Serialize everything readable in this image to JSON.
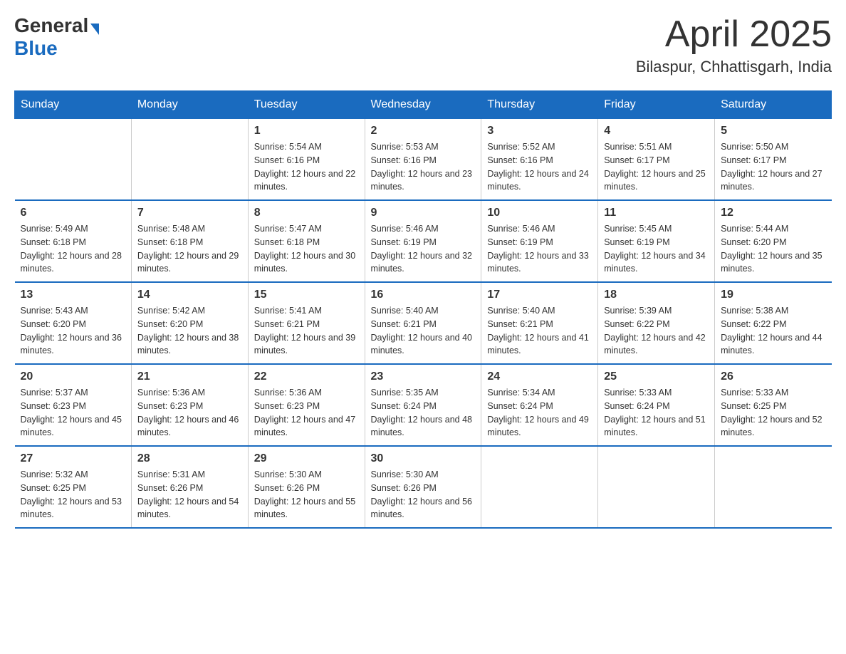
{
  "header": {
    "logo_general": "General",
    "logo_blue": "Blue",
    "month": "April 2025",
    "location": "Bilaspur, Chhattisgarh, India"
  },
  "weekdays": [
    "Sunday",
    "Monday",
    "Tuesday",
    "Wednesday",
    "Thursday",
    "Friday",
    "Saturday"
  ],
  "weeks": [
    [
      {
        "day": "",
        "sunrise": "",
        "sunset": "",
        "daylight": ""
      },
      {
        "day": "",
        "sunrise": "",
        "sunset": "",
        "daylight": ""
      },
      {
        "day": "1",
        "sunrise": "Sunrise: 5:54 AM",
        "sunset": "Sunset: 6:16 PM",
        "daylight": "Daylight: 12 hours and 22 minutes."
      },
      {
        "day": "2",
        "sunrise": "Sunrise: 5:53 AM",
        "sunset": "Sunset: 6:16 PM",
        "daylight": "Daylight: 12 hours and 23 minutes."
      },
      {
        "day": "3",
        "sunrise": "Sunrise: 5:52 AM",
        "sunset": "Sunset: 6:16 PM",
        "daylight": "Daylight: 12 hours and 24 minutes."
      },
      {
        "day": "4",
        "sunrise": "Sunrise: 5:51 AM",
        "sunset": "Sunset: 6:17 PM",
        "daylight": "Daylight: 12 hours and 25 minutes."
      },
      {
        "day": "5",
        "sunrise": "Sunrise: 5:50 AM",
        "sunset": "Sunset: 6:17 PM",
        "daylight": "Daylight: 12 hours and 27 minutes."
      }
    ],
    [
      {
        "day": "6",
        "sunrise": "Sunrise: 5:49 AM",
        "sunset": "Sunset: 6:18 PM",
        "daylight": "Daylight: 12 hours and 28 minutes."
      },
      {
        "day": "7",
        "sunrise": "Sunrise: 5:48 AM",
        "sunset": "Sunset: 6:18 PM",
        "daylight": "Daylight: 12 hours and 29 minutes."
      },
      {
        "day": "8",
        "sunrise": "Sunrise: 5:47 AM",
        "sunset": "Sunset: 6:18 PM",
        "daylight": "Daylight: 12 hours and 30 minutes."
      },
      {
        "day": "9",
        "sunrise": "Sunrise: 5:46 AM",
        "sunset": "Sunset: 6:19 PM",
        "daylight": "Daylight: 12 hours and 32 minutes."
      },
      {
        "day": "10",
        "sunrise": "Sunrise: 5:46 AM",
        "sunset": "Sunset: 6:19 PM",
        "daylight": "Daylight: 12 hours and 33 minutes."
      },
      {
        "day": "11",
        "sunrise": "Sunrise: 5:45 AM",
        "sunset": "Sunset: 6:19 PM",
        "daylight": "Daylight: 12 hours and 34 minutes."
      },
      {
        "day": "12",
        "sunrise": "Sunrise: 5:44 AM",
        "sunset": "Sunset: 6:20 PM",
        "daylight": "Daylight: 12 hours and 35 minutes."
      }
    ],
    [
      {
        "day": "13",
        "sunrise": "Sunrise: 5:43 AM",
        "sunset": "Sunset: 6:20 PM",
        "daylight": "Daylight: 12 hours and 36 minutes."
      },
      {
        "day": "14",
        "sunrise": "Sunrise: 5:42 AM",
        "sunset": "Sunset: 6:20 PM",
        "daylight": "Daylight: 12 hours and 38 minutes."
      },
      {
        "day": "15",
        "sunrise": "Sunrise: 5:41 AM",
        "sunset": "Sunset: 6:21 PM",
        "daylight": "Daylight: 12 hours and 39 minutes."
      },
      {
        "day": "16",
        "sunrise": "Sunrise: 5:40 AM",
        "sunset": "Sunset: 6:21 PM",
        "daylight": "Daylight: 12 hours and 40 minutes."
      },
      {
        "day": "17",
        "sunrise": "Sunrise: 5:40 AM",
        "sunset": "Sunset: 6:21 PM",
        "daylight": "Daylight: 12 hours and 41 minutes."
      },
      {
        "day": "18",
        "sunrise": "Sunrise: 5:39 AM",
        "sunset": "Sunset: 6:22 PM",
        "daylight": "Daylight: 12 hours and 42 minutes."
      },
      {
        "day": "19",
        "sunrise": "Sunrise: 5:38 AM",
        "sunset": "Sunset: 6:22 PM",
        "daylight": "Daylight: 12 hours and 44 minutes."
      }
    ],
    [
      {
        "day": "20",
        "sunrise": "Sunrise: 5:37 AM",
        "sunset": "Sunset: 6:23 PM",
        "daylight": "Daylight: 12 hours and 45 minutes."
      },
      {
        "day": "21",
        "sunrise": "Sunrise: 5:36 AM",
        "sunset": "Sunset: 6:23 PM",
        "daylight": "Daylight: 12 hours and 46 minutes."
      },
      {
        "day": "22",
        "sunrise": "Sunrise: 5:36 AM",
        "sunset": "Sunset: 6:23 PM",
        "daylight": "Daylight: 12 hours and 47 minutes."
      },
      {
        "day": "23",
        "sunrise": "Sunrise: 5:35 AM",
        "sunset": "Sunset: 6:24 PM",
        "daylight": "Daylight: 12 hours and 48 minutes."
      },
      {
        "day": "24",
        "sunrise": "Sunrise: 5:34 AM",
        "sunset": "Sunset: 6:24 PM",
        "daylight": "Daylight: 12 hours and 49 minutes."
      },
      {
        "day": "25",
        "sunrise": "Sunrise: 5:33 AM",
        "sunset": "Sunset: 6:24 PM",
        "daylight": "Daylight: 12 hours and 51 minutes."
      },
      {
        "day": "26",
        "sunrise": "Sunrise: 5:33 AM",
        "sunset": "Sunset: 6:25 PM",
        "daylight": "Daylight: 12 hours and 52 minutes."
      }
    ],
    [
      {
        "day": "27",
        "sunrise": "Sunrise: 5:32 AM",
        "sunset": "Sunset: 6:25 PM",
        "daylight": "Daylight: 12 hours and 53 minutes."
      },
      {
        "day": "28",
        "sunrise": "Sunrise: 5:31 AM",
        "sunset": "Sunset: 6:26 PM",
        "daylight": "Daylight: 12 hours and 54 minutes."
      },
      {
        "day": "29",
        "sunrise": "Sunrise: 5:30 AM",
        "sunset": "Sunset: 6:26 PM",
        "daylight": "Daylight: 12 hours and 55 minutes."
      },
      {
        "day": "30",
        "sunrise": "Sunrise: 5:30 AM",
        "sunset": "Sunset: 6:26 PM",
        "daylight": "Daylight: 12 hours and 56 minutes."
      },
      {
        "day": "",
        "sunrise": "",
        "sunset": "",
        "daylight": ""
      },
      {
        "day": "",
        "sunrise": "",
        "sunset": "",
        "daylight": ""
      },
      {
        "day": "",
        "sunrise": "",
        "sunset": "",
        "daylight": ""
      }
    ]
  ]
}
